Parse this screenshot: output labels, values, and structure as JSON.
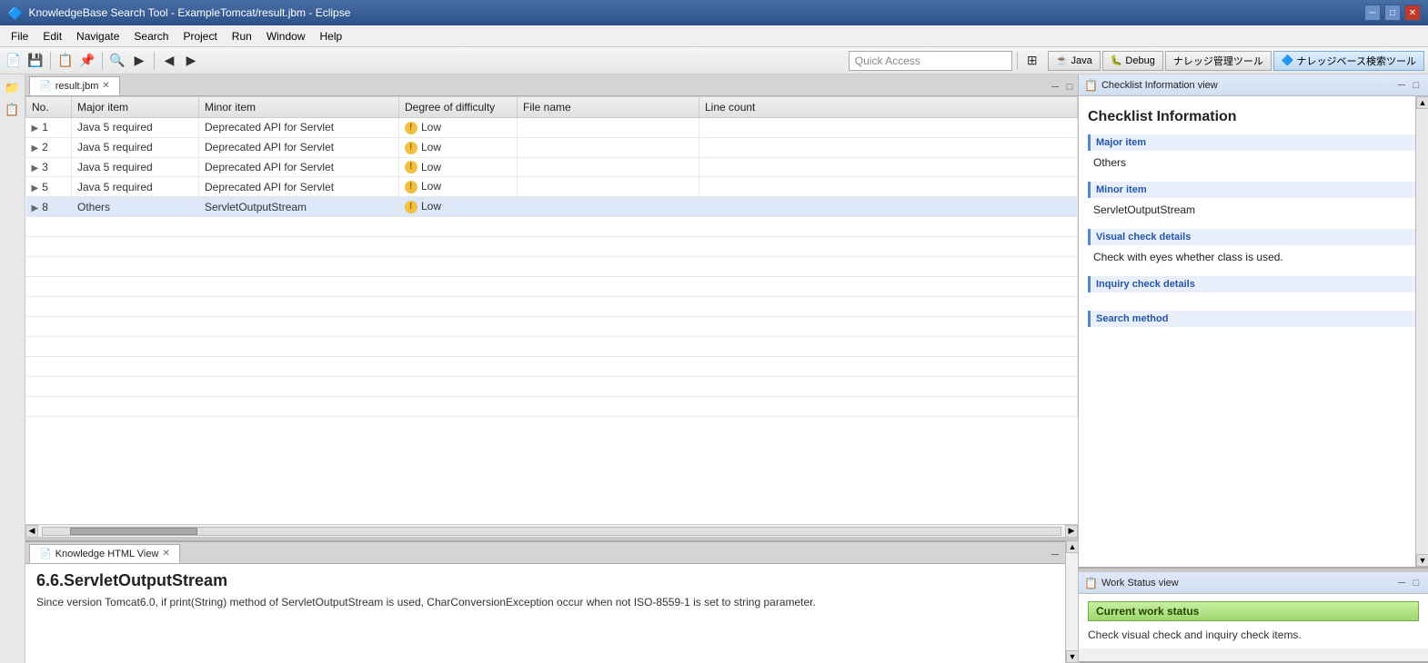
{
  "titleBar": {
    "title": "KnowledgeBase Search Tool - ExampleTomcat/result.jbm - Eclipse",
    "icon": "🔷",
    "controls": [
      "─",
      "□",
      "✕"
    ]
  },
  "menuBar": {
    "items": [
      "File",
      "Edit",
      "Navigate",
      "Search",
      "Project",
      "Run",
      "Window",
      "Help"
    ]
  },
  "toolbar": {
    "quickAccessPlaceholder": "Quick Access",
    "perspectives": [
      {
        "label": "Java",
        "icon": "☕",
        "active": false
      },
      {
        "label": "Debug",
        "icon": "🐛",
        "active": false
      },
      {
        "label": "ナレッジ管理ツール",
        "icon": "📋",
        "active": false
      },
      {
        "label": "ナレッジベース検索ツール",
        "icon": "🔷",
        "active": true
      }
    ]
  },
  "resultTable": {
    "tabLabel": "result.jbm",
    "tabClose": "✕",
    "columns": [
      "No.",
      "Major item",
      "Minor item",
      "Degree of difficulty",
      "File name",
      "Line count"
    ],
    "rows": [
      {
        "no": "1",
        "majorItem": "Java 5 required",
        "minorItem": "Deprecated API for Servlet",
        "difficulty": "Low",
        "fileName": "",
        "lineCount": ""
      },
      {
        "no": "2",
        "majorItem": "Java 5 required",
        "minorItem": "Deprecated API for Servlet",
        "difficulty": "Low",
        "fileName": "",
        "lineCount": ""
      },
      {
        "no": "3",
        "majorItem": "Java 5 required",
        "minorItem": "Deprecated API for Servlet",
        "difficulty": "Low",
        "fileName": "",
        "lineCount": ""
      },
      {
        "no": "5",
        "majorItem": "Java 5 required",
        "minorItem": "Deprecated API for Servlet",
        "difficulty": "Low",
        "fileName": "",
        "lineCount": ""
      },
      {
        "no": "8",
        "majorItem": "Others",
        "minorItem": "ServletOutputStream",
        "difficulty": "Low",
        "fileName": "",
        "lineCount": ""
      }
    ]
  },
  "bottomPanel": {
    "tabLabel": "Knowledge HTML View",
    "tabClose": "✕",
    "title": "6.6.ServletOutputStream",
    "description": "Since version Tomcat6.0, if print(String) method of ServletOutputStream is used, CharConversionException occur when not ISO-8559-1 is set to string parameter."
  },
  "checklistPanel": {
    "title": "Checklist Information view",
    "titleClose": "✕",
    "mainTitle": "Checklist Information",
    "sections": [
      {
        "header": "Major item",
        "value": "Others"
      },
      {
        "header": "Minor item",
        "value": "ServletOutputStream"
      },
      {
        "header": "Visual check details",
        "value": "Check with eyes whether class is used."
      },
      {
        "header": "Inquiry check details",
        "value": ""
      },
      {
        "header": "Search method",
        "value": ""
      }
    ]
  },
  "workStatusPanel": {
    "title": "Work Status view",
    "titleClose": "✕",
    "currentStatus": "Current work status",
    "statusText": "Check visual check and inquiry check items."
  }
}
